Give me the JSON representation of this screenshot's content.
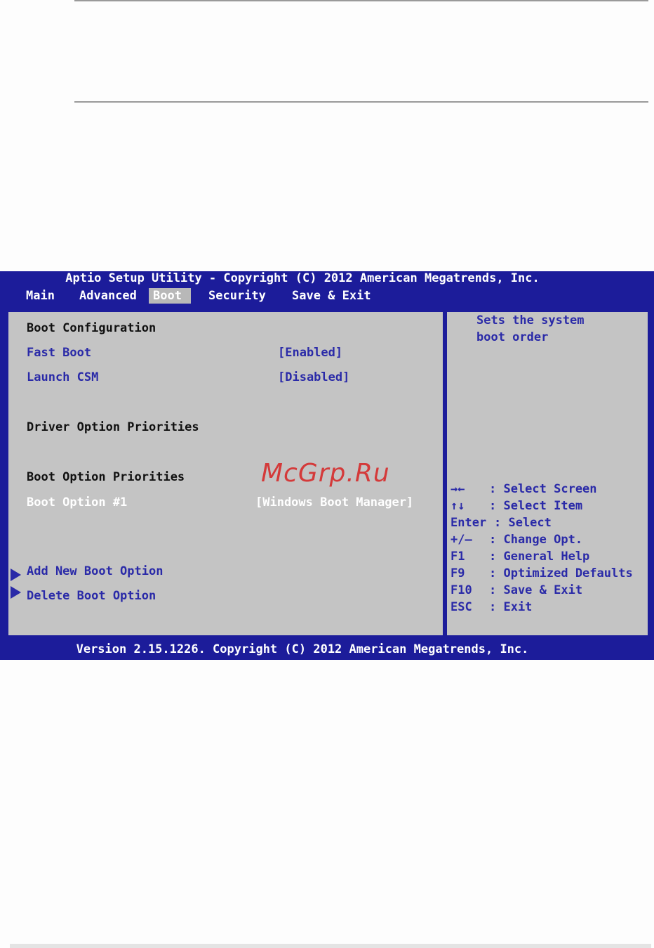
{
  "bios": {
    "title": "Aptio Setup Utility - Copyright (C) 2012 American Megatrends, Inc.",
    "footer": "Version 2.15.1226. Copyright (C) 2012 American Megatrends, Inc.",
    "menu": [
      "Main",
      "Advanced",
      "Boot",
      "Security",
      "Save & Exit"
    ],
    "active_menu": "Boot"
  },
  "boot": {
    "boot_config_header": "Boot Configuration",
    "fast_boot_label": "Fast Boot",
    "fast_boot_value": "[Enabled]",
    "launch_csm_label": "Launch CSM",
    "launch_csm_value": "[Disabled]",
    "driver_priorities_header": "Driver Option Priorities",
    "boot_priorities_header": "Boot Option Priorities",
    "boot_option1_label": "Boot Option #1",
    "boot_option1_value": "[Windows Boot Manager]",
    "add_new_boot_option": "Add New Boot Option",
    "delete_boot_option": "Delete Boot Option"
  },
  "help": {
    "line1": "Sets the system",
    "line2": "boot order"
  },
  "keys": [
    {
      "key": "→←   ",
      "desc": ": Select Screen"
    },
    {
      "key": "↑↓   ",
      "desc": ": Select Item"
    },
    {
      "key": "Enter",
      "desc": ": Select"
    },
    {
      "key": "+/—  ",
      "desc": ": Change Opt."
    },
    {
      "key": "F1   ",
      "desc": ": General Help"
    },
    {
      "key": "F9   ",
      "desc": ": Optimized Defaults"
    },
    {
      "key": "F10  ",
      "desc": ": Save & Exit"
    },
    {
      "key": "ESC  ",
      "desc": ": Exit"
    }
  ],
  "watermark": "McGrp.Ru",
  "colors": {
    "bios_blue": "#1c1c9a",
    "panel_gray": "#c4c4c4",
    "option_blue": "#2a2aa8",
    "watermark_red": "#d43a3a"
  }
}
